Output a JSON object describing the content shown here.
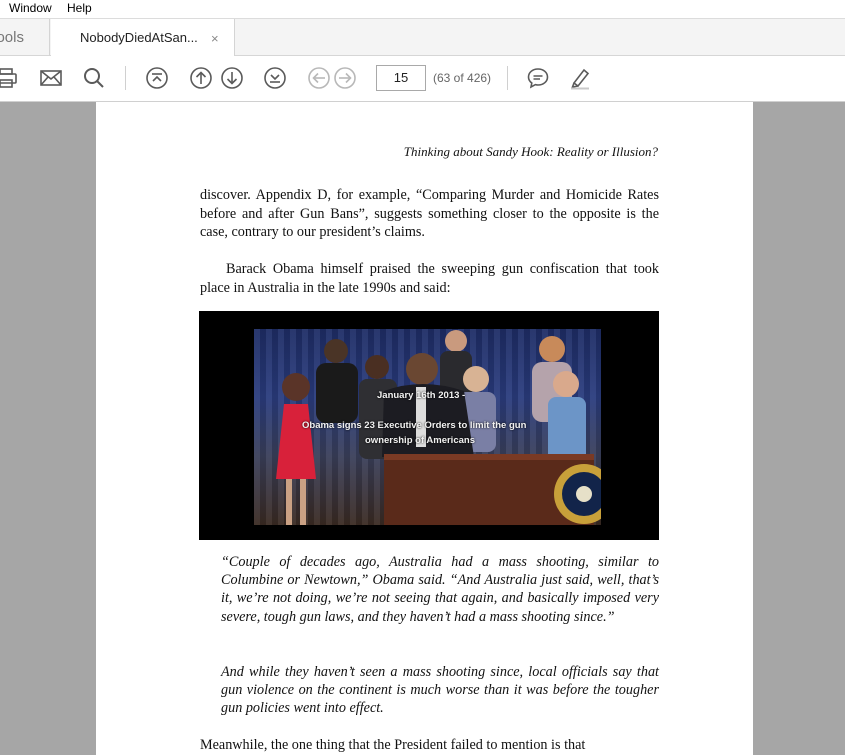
{
  "menu": {
    "window": "Window",
    "help": "Help"
  },
  "tabs": {
    "tools": "Tools",
    "document": "NobodyDiedAtSan...",
    "close": "×"
  },
  "toolbar": {
    "page_number": "15",
    "page_count": "(63 of 426)",
    "icons": [
      "print-icon",
      "email-icon",
      "search-icon",
      "first-page-icon",
      "previous-page-icon",
      "next-page-icon",
      "last-page-icon",
      "back-icon",
      "forward-icon",
      "comment-icon",
      "highlight-icon"
    ]
  },
  "document": {
    "running_head": "Thinking about Sandy Hook: Reality or Illusion?",
    "para1": "discover. Appendix D, for example, “Comparing Murder and Homicide Rates before and after Gun Bans”, suggests something closer to the opposite is the case, contrary to our president’s claims.",
    "para2": "Barack Obama himself praised the sweeping gun confiscation that took place in Australia in the late 1990s and said:",
    "photo_caption_1": "January 16th 2013 -",
    "photo_caption_2": "Obama signs 23 Executive Orders to limit the gun",
    "photo_caption_3": "ownership of Americans",
    "quote1": "“Couple of decades ago, Australia had a mass shooting, similar to Columbine or Newtown,” Obama said. “And Australia just said, well, that’s it, we’re not doing, we’re not seeing that again, and basically imposed very severe, tough gun laws, and they haven’t had a mass shooting since.”",
    "quote2": "And while they haven’t seen a mass shooting since, local officials say that gun violence on the continent is much worse than it was before the tougher gun policies went into effect.",
    "para3_partial": "Meanwhile, the one thing that the President failed to mention is that"
  },
  "colors": {
    "doc_background": "#a6a6a6",
    "icon_color": "#5a5a5a"
  }
}
